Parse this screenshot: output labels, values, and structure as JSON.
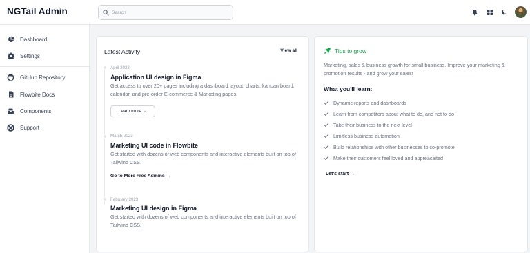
{
  "brand": "NGTail Admin",
  "search": {
    "placeholder": "Search"
  },
  "topbar_icons": [
    "bell-icon",
    "apps-grid-icon",
    "moon-icon",
    "user-avatar"
  ],
  "sidebar": {
    "items": [
      {
        "label": "Dashboard",
        "icon": "pie-chart-icon"
      },
      {
        "label": "Settings",
        "icon": "gear-icon"
      },
      {
        "label": "GitHub Repository",
        "icon": "github-icon"
      },
      {
        "label": "Flowbite Docs",
        "icon": "document-icon"
      },
      {
        "label": "Components",
        "icon": "inbox-stack-icon"
      },
      {
        "label": "Support",
        "icon": "lifebuoy-icon"
      }
    ]
  },
  "activity": {
    "title": "Latest Activity",
    "view_all": "View all",
    "items": [
      {
        "date": "April 2023",
        "title": "Application UI design in Figma",
        "description": "Get access to over 20+ pages including a dashboard layout, charts, kanban board, calendar, and pre-order E-commerce & Marketing pages.",
        "action": "Learn more →"
      },
      {
        "date": "March 2023",
        "title": "Marketing UI code in Flowbite",
        "description": "Get started with dozens of web components and interactive elements built on top of Tailwind CSS.",
        "action": "Go to More Free Admins →"
      },
      {
        "date": "February 2023",
        "title": "Marketing UI design in Figma",
        "description": "Get started with dozens of web components and interactive elements built on top of Tailwind CSS."
      }
    ]
  },
  "tips": {
    "title": "Tips to grow",
    "description": "Marketing, sales & business growth for small business. Improve your marketing & promotion results - and grow your sales!",
    "learn_title": "What you'll learn:",
    "items": [
      "Dynamic reports and dashboards",
      "Learn from competitors about what to do, and not to do",
      "Take their business to the next level",
      "Limitless business automation",
      "Build relationships with other businesses to co-promote",
      "Make their customers feel loved and appreacaited"
    ],
    "cta": "Let's start →"
  },
  "colors": {
    "accent": "#16a34a",
    "text": "#111827",
    "muted": "#6b7280",
    "background": "#f3f4f6"
  }
}
